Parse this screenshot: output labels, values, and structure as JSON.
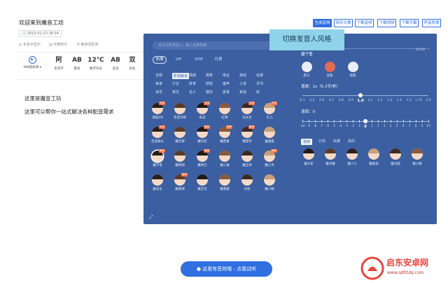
{
  "header": {
    "title": "欢迎来到魔音工坊",
    "date": "2022-01-23 16:34",
    "actions": [
      "生成音频",
      "保存文案",
      "下载音频",
      "下载视频",
      "下载字幕",
      "声音转换"
    ]
  },
  "meta": [
    "多音字显示",
    "字数统计",
    "敏感词检测"
  ],
  "toolbar": {
    "speaker_label": "48k超高清",
    "tools": [
      {
        "icon": "阿",
        "label": "多音字"
      },
      {
        "icon": "AB",
        "label": "重读"
      },
      {
        "icon": "12℃",
        "label": "数字符号"
      },
      {
        "icon": "AB",
        "label": "连读"
      },
      {
        "icon": "双",
        "label": "别名"
      }
    ]
  },
  "editor": {
    "lines": [
      "这里是魔音工坊",
      "这里可以帮你一站式解决各种配音需求"
    ]
  },
  "voice_panel": {
    "search_placeholder": "共311款发音人，输入名称搜索",
    "tabs": [
      "热情",
      "VIP",
      "SVIP",
      "付费"
    ],
    "categories": [
      [
        "全部",
        "影视解说",
        "情感",
        "搞笑",
        "电台",
        "游戏",
        "动漫"
      ],
      [
        "美食",
        "方言",
        "体育",
        "财经",
        "童声",
        "小说",
        "评书"
      ],
      [
        "资讯",
        "英文",
        "名人",
        "模仿",
        "故事",
        "其他",
        "收"
      ]
    ],
    "voices": [
      {
        "name": "清超ZN",
        "tag": "大咖"
      },
      {
        "name": "百变毕婷",
        "tag": ""
      },
      {
        "name": "采菜",
        "tag": "大咖"
      },
      {
        "name": "红晴",
        "tag": ""
      },
      {
        "name": "恺长老",
        "tag": "大咖"
      },
      {
        "name": "贝儿",
        "tag": "大咖"
      },
      {
        "name": "百变振长",
        "tag": "大咖"
      },
      {
        "name": "魔云那",
        "tag": ""
      },
      {
        "name": "魔天轮",
        "tag": "推荐"
      },
      {
        "name": "魔西葛",
        "tag": "推荐"
      },
      {
        "name": "魔雷宇",
        "tag": "推荐"
      },
      {
        "name": "屠睿晨",
        "tag": ""
      },
      {
        "name": "魔千雪",
        "tag": "推荐"
      },
      {
        "name": "魔阿刚",
        "tag": ""
      },
      {
        "name": "魔阳巳",
        "tag": "推荐"
      },
      {
        "name": "魔小藻",
        "tag": ""
      },
      {
        "name": "魔正泽",
        "tag": ""
      },
      {
        "name": "魔小杰",
        "tag": "推荐"
      },
      {
        "name": "魔北号",
        "tag": ""
      },
      {
        "name": "魔骆瑞",
        "tag": "推荐"
      },
      {
        "name": "魔艾伦",
        "tag": ""
      },
      {
        "name": "魔萧瑟",
        "tag": ""
      },
      {
        "name": "谷伯",
        "tag": ""
      },
      {
        "name": "魔小颖",
        "tag": ""
      }
    ]
  },
  "right": {
    "progress_time": "00:20",
    "selected_voice": "魔千雪",
    "styles": [
      "默认",
      "温柔",
      "经典"
    ],
    "speed_label": "语速：1x（5.2字/秒）",
    "speed_ticks": [
      "0.1",
      "0.5",
      "0.6",
      "0.7",
      "0.8",
      "0.9",
      "1.0",
      "1.1",
      "1.2",
      "1.3",
      "1.4",
      "1.5",
      "1.75",
      "2.0"
    ],
    "speed_value": "1.0",
    "pitch_label": "语调：0",
    "pitch_ticks": [
      "-10",
      "-9",
      "-8",
      "-7",
      "-6",
      "-5",
      "-4",
      "-3",
      "-2",
      "-1",
      "0",
      "1",
      "2",
      "3",
      "4",
      "5",
      "6",
      "7",
      "8",
      "9",
      "10"
    ],
    "pitch_value": "0",
    "tabs": [
      "常用",
      "已购",
      "收藏",
      "我的"
    ],
    "common_voices": [
      "魔天轮",
      "魔书睿",
      "魔小七",
      "魔俊逸",
      "魔灵越",
      "魔小颖"
    ]
  },
  "tooltip": "切换发音人风格",
  "cta_label": "这里有音效哦 - 点我试听",
  "watermark": {
    "name": "启东安卓网",
    "url": "www.qdlttdq.com"
  },
  "colors": {
    "accent": "#2f6fe0",
    "panel": "#3b5fa0",
    "tooltip": "#8fd3e8"
  }
}
